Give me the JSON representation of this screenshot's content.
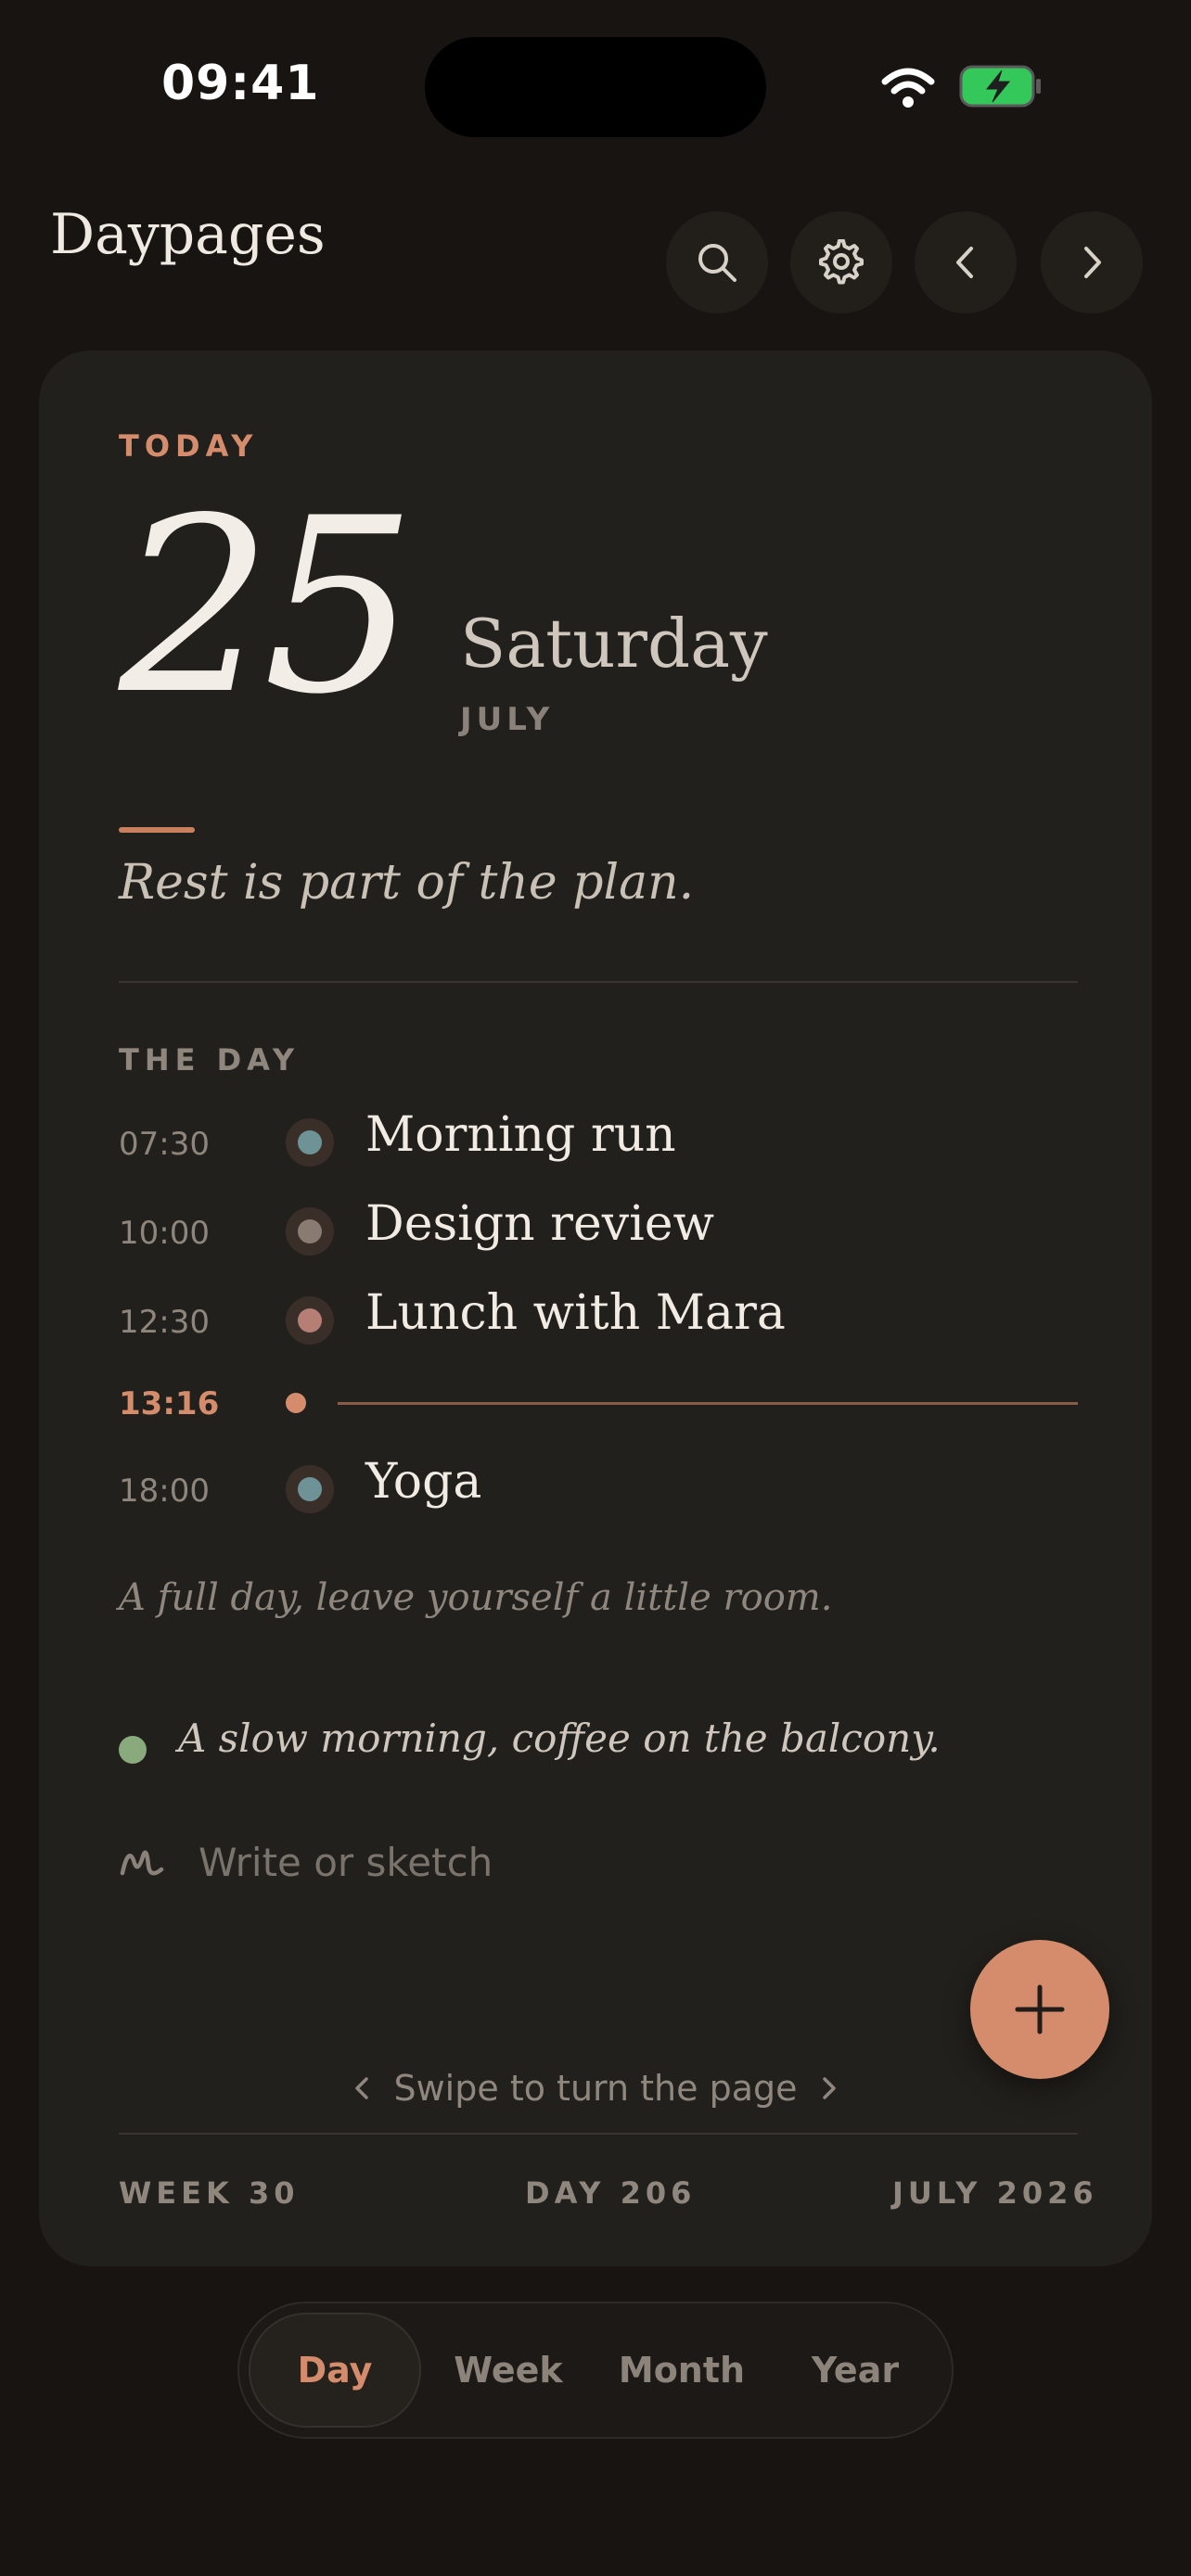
{
  "status": {
    "time": "09:41"
  },
  "header": {
    "app_title": "Daypages"
  },
  "colors": {
    "accent": "#d48c6c",
    "background": "#171412",
    "card": "#22201c",
    "note_green": "#88aa7c"
  },
  "icons": [
    "search-icon",
    "gear-icon",
    "chevron-left-icon",
    "chevron-right-icon",
    "scribble-icon",
    "plus-icon",
    "wifi-icon",
    "battery-charging-icon"
  ],
  "day": {
    "label": "TODAY",
    "date_number": "25",
    "weekday": "Saturday",
    "month": "JULY",
    "motto": "Rest is part of the plan."
  },
  "schedule": {
    "label": "THE DAY",
    "events": [
      {
        "time": "07:30",
        "title": "Morning run",
        "color": "#6e9396"
      },
      {
        "time": "10:00",
        "title": "Design review",
        "color": "#8a7b72"
      },
      {
        "time": "12:30",
        "title": "Lunch with Mara",
        "color": "#b57f76"
      },
      {
        "time": "18:00",
        "title": "Yoga",
        "color": "#6e9396"
      }
    ],
    "now_time": "13:16",
    "hint": "A full day, leave yourself a little room."
  },
  "note": {
    "text": "A slow morning, coffee on the balcony."
  },
  "composer": {
    "placeholder": "Write or sketch"
  },
  "swipe_hint": "Swipe to turn the page",
  "footer": {
    "week": "WEEK 30",
    "day": "DAY 206",
    "month_year": "JULY 2026"
  },
  "view_switcher": {
    "items": [
      "Day",
      "Week",
      "Month",
      "Year"
    ],
    "selected": "Day"
  }
}
